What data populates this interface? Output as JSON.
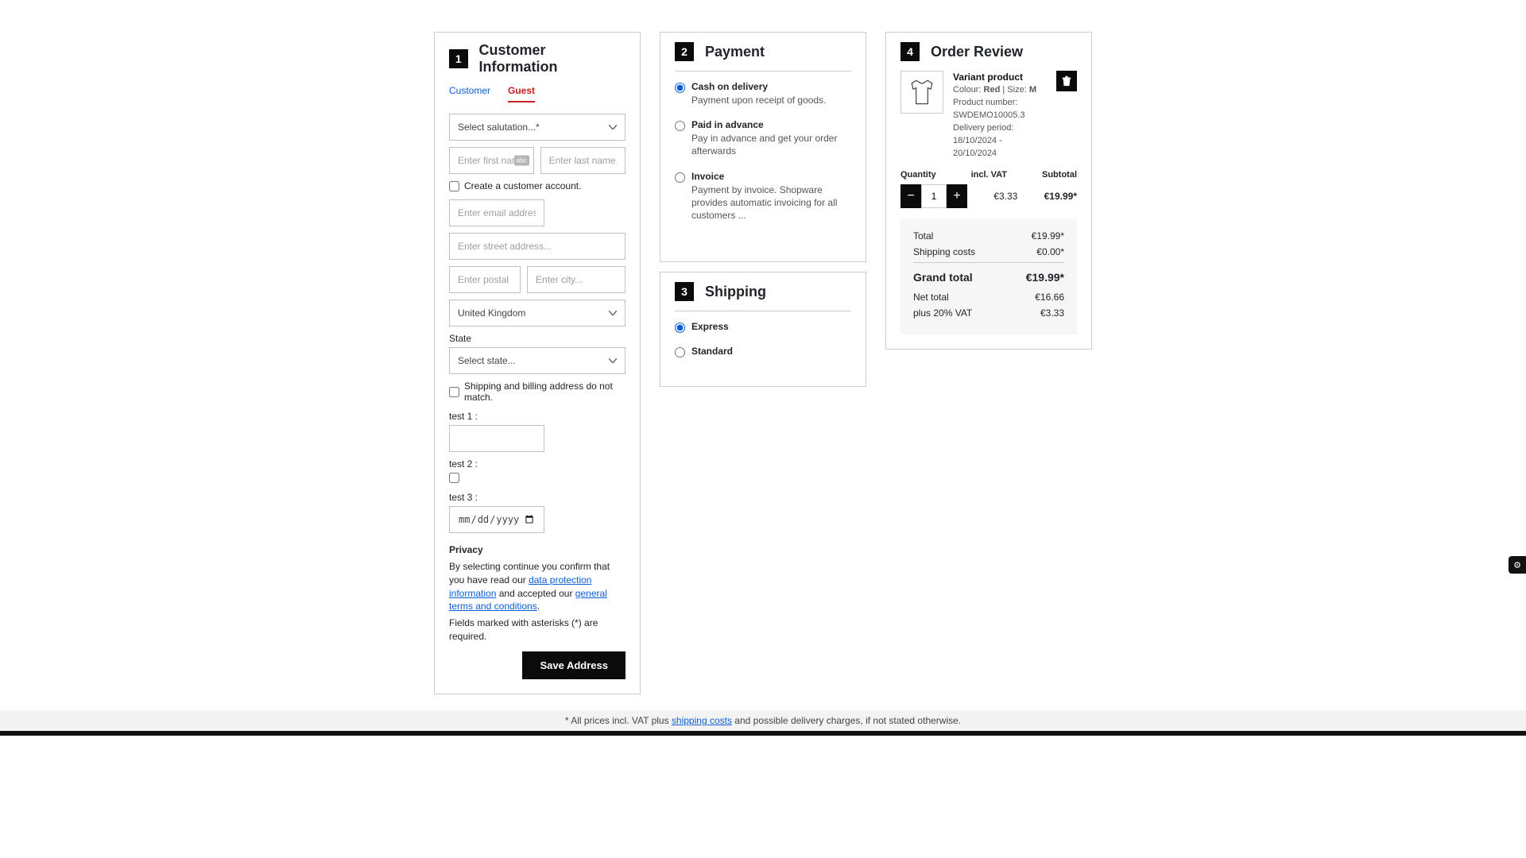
{
  "steps": {
    "customer_info": {
      "num": "1",
      "title": "Customer Information"
    },
    "payment": {
      "num": "2",
      "title": "Payment"
    },
    "shipping": {
      "num": "3",
      "title": "Shipping"
    },
    "review": {
      "num": "4",
      "title": "Order Review"
    }
  },
  "tabs": {
    "customer": "Customer",
    "guest": "Guest"
  },
  "form": {
    "salutation_placeholder": "Select salutation...*",
    "first_name_placeholder": "Enter first name...",
    "last_name_placeholder": "Enter last name...",
    "create_account_label": "Create a customer account.",
    "email_placeholder": "Enter email address...",
    "street_placeholder": "Enter street address...",
    "postal_placeholder": "Enter postal code",
    "city_placeholder": "Enter city...",
    "country_selected": "United Kingdom",
    "state_label": "State",
    "state_placeholder": "Select state...",
    "ship_bill_diff_label": "Shipping and billing address do not match.",
    "test1_label": "test 1 :",
    "test2_label": "test 2 :",
    "test3_label": "test 3 :",
    "date_placeholder": "dd/mm/yyyy"
  },
  "privacy": {
    "heading": "Privacy",
    "prefix": "By selecting continue you confirm that you have read our ",
    "link1": "data protection information",
    "mid": " and accepted our ",
    "link2": "general terms and conditions",
    "suffix": ".",
    "asterisk_note": "Fields marked with asterisks (*) are required.",
    "save_label": "Save Address"
  },
  "payment": {
    "options": [
      {
        "title": "Cash on delivery",
        "desc": "Payment upon receipt of goods.",
        "selected": true
      },
      {
        "title": "Paid in advance",
        "desc": "Pay in advance and get your order afterwards",
        "selected": false
      },
      {
        "title": "Invoice",
        "desc": "Payment by invoice. Shopware provides automatic invoicing for all customers ...",
        "selected": false
      }
    ]
  },
  "shipping": {
    "options": [
      {
        "title": "Express",
        "selected": true
      },
      {
        "title": "Standard",
        "selected": false
      }
    ]
  },
  "review": {
    "product": {
      "name": "Variant product",
      "colour_label": "Colour:",
      "colour": "Red",
      "size_label": "Size:",
      "size": "M",
      "number_label": "Product number:",
      "number": "SWDEMO10005.3",
      "delivery_label": "Delivery period:",
      "delivery": "18/10/2024 - 20/10/2024"
    },
    "headers": {
      "qty": "Quantity",
      "vat": "incl. VAT",
      "sub": "Subtotal"
    },
    "qty_value": "1",
    "incl_vat": "€3.33",
    "subtotal": "€19.99*",
    "totals": {
      "total_label": "Total",
      "total": "€19.99*",
      "ship_label": "Shipping costs",
      "ship": "€0.00*",
      "grand_label": "Grand total",
      "grand": "€19.99*",
      "net_label": "Net total",
      "net": "€16.66",
      "vat_label": "plus 20% VAT",
      "vat": "€3.33"
    }
  },
  "footer": {
    "prefix": "* All prices incl. VAT plus ",
    "link": "shipping costs",
    "suffix": " and possible delivery charges, if not stated otherwise."
  }
}
